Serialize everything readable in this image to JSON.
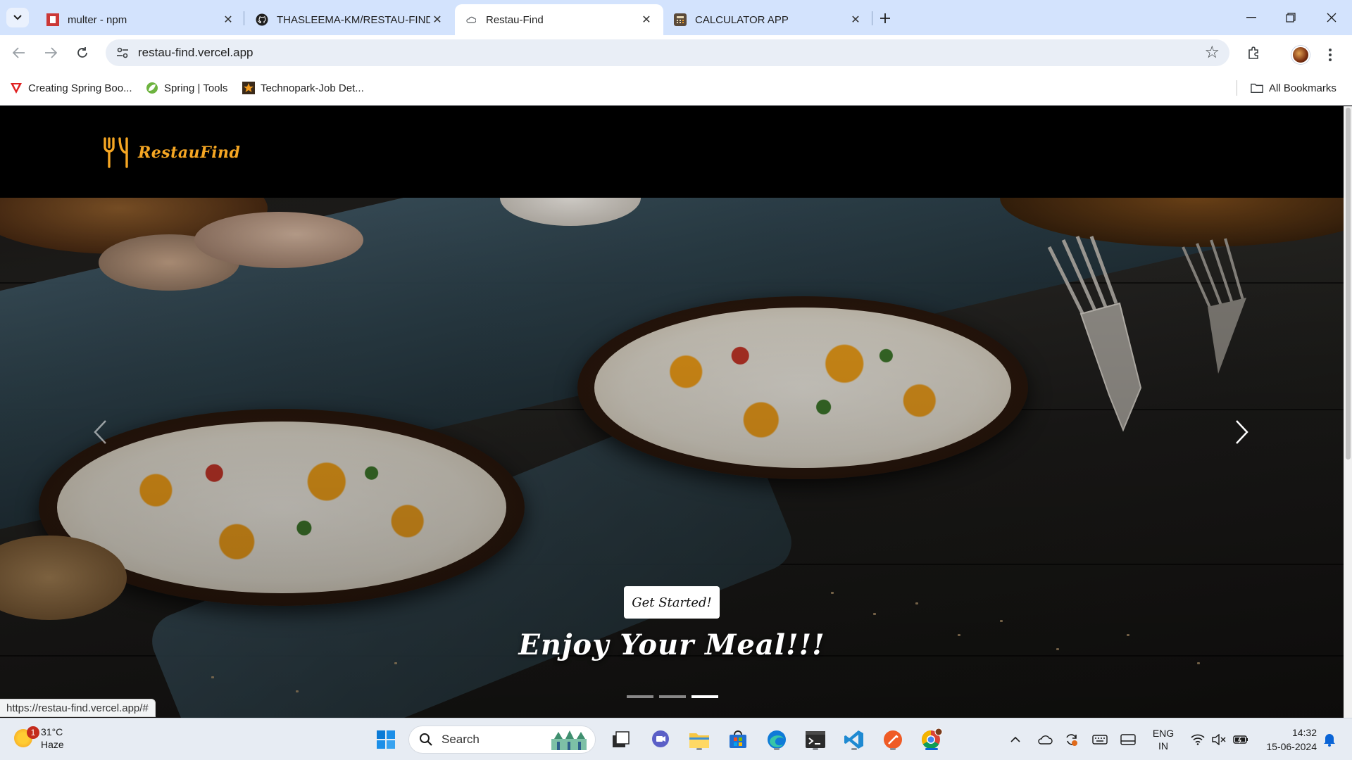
{
  "browser": {
    "tabs": [
      {
        "title": "multer - npm",
        "icon": "npm-icon",
        "active": false
      },
      {
        "title": "THASLEEMA-KM/RESTAU-FIND",
        "icon": "github-icon",
        "active": false
      },
      {
        "title": "Restau-Find",
        "icon": "cloud-icon",
        "active": true
      },
      {
        "title": "CALCULATOR APP",
        "icon": "calculator-icon",
        "active": false
      }
    ],
    "url": "restau-find.vercel.app",
    "bookmarks": [
      {
        "label": "Creating Spring Boo...",
        "icon": "red-v-icon"
      },
      {
        "label": "Spring | Tools",
        "icon": "spring-leaf-icon"
      },
      {
        "label": "Technopark-Job Det...",
        "icon": "star-box-icon"
      }
    ],
    "all_bookmarks_label": "All Bookmarks",
    "status_url": "https://restau-find.vercel.app/#"
  },
  "site": {
    "logo_text": "RestauFind",
    "cta_label": "Get Started!",
    "tagline": "Enjoy Your Meal!!!",
    "carousel": {
      "slides": 3,
      "active_index": 2
    }
  },
  "taskbar": {
    "weather": {
      "temp": "31°C",
      "condition": "Haze",
      "badge": "1"
    },
    "search_label": "Search",
    "language": {
      "line1": "ENG",
      "line2": "IN"
    },
    "time": "14:32",
    "date": "15-06-2024"
  },
  "colors": {
    "brand": "#f5a623",
    "tabstrip": "#d3e3fd",
    "taskbar": "#e7ecf3"
  }
}
